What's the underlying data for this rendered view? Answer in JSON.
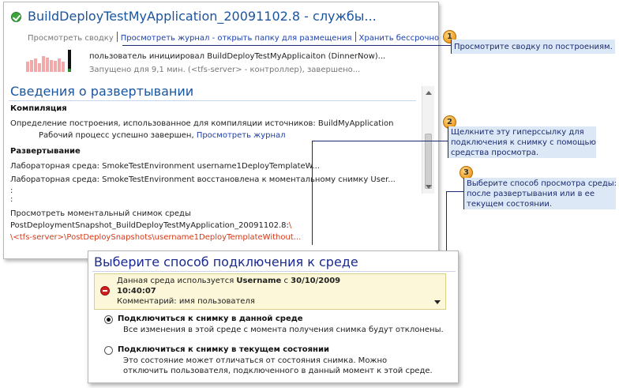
{
  "build": {
    "title": "BuildDeployTestMyApplication_20091102.8 - службы...",
    "links": {
      "summary": "Просмотреть сводку",
      "log_open": "Просмотреть журнал - открыть папку для размещения",
      "keep": "Хранить бессрочно"
    },
    "initiated": "пользователь инициировал BuildDeployTestMyApplicaiton (DinnerNow)...",
    "running": "Запущено для 9,1 мин. (<tfs-server> - контроллер), завершено...",
    "history_bars": [
      {
        "height": 0.45,
        "status": "failed"
      },
      {
        "height": 0.55,
        "status": "failed"
      },
      {
        "height": 0.6,
        "status": "failed"
      },
      {
        "height": 0.4,
        "status": "failed"
      },
      {
        "height": 0.7,
        "status": "failed"
      },
      {
        "height": 0.65,
        "status": "failed"
      },
      {
        "height": 0.55,
        "status": "failed"
      },
      {
        "height": 0.5,
        "status": "failed"
      },
      {
        "height": 0.6,
        "status": "failed"
      },
      {
        "height": 0.45,
        "status": "failed"
      },
      {
        "height": 1.0,
        "status": "current"
      }
    ]
  },
  "deployment": {
    "section_title": "Сведения о развертывании",
    "compile_heading": "Компиляция",
    "compile_definition": "Определение построения, использованное для компиляции источников: BuildMyApplication",
    "compile_result": "Рабочий процесс успешно завершен,",
    "compile_log_link": "Просмотреть журнал",
    "deploy_heading": "Развертывание",
    "lab_line1": "Лабораторная среда: SmokeTestEnvironment username1DeployTemplateW...",
    "lab_line2": "Лабораторная среда: SmokeTestEnvironment восстановлена к моментальному снимку User...",
    "dots": ":",
    "snapshot_label": "Просмотреть моментальный снимок среды",
    "snapshot_name": "PostDeploymentSnapshot_BuildDeployTestMyApplication_20091102.8:",
    "snapshot_suffix": "\\",
    "snapshot_path": "\\<tfs-server>\\PostDeploySnapshots\\username1DeployTemplateWithout..."
  },
  "callouts": [
    {
      "number": "1",
      "lines": [
        "Просмотрите сводку по построениям."
      ]
    },
    {
      "number": "2",
      "lines": [
        "Щелкните эту гиперссылку для",
        "подключения к снимку с помощью",
        "средства просмотра."
      ]
    },
    {
      "number": "3",
      "lines": [
        "Выберите способ просмотра среды:",
        "после развертывания или в ее",
        "текущем состоянии."
      ]
    }
  ],
  "connect": {
    "title": "Выберите способ подключения к среде",
    "warning_prefix": "Данная среда используется",
    "warning_user": "Username",
    "warning_with": "с",
    "warning_date": "30/10/2009",
    "warning_time": "10:40:07",
    "warning_comment": "Комментарий: имя пользователя",
    "option1_title": "Подключиться к снимку в данной среде",
    "option1_desc": "Все изменения в этой среде с момента получения снимка будут отклонены.",
    "option2_title": "Подключиться к снимку в текущем состоянии",
    "option2_desc1": "Это состояние может отличаться от состояния снимка. Можно",
    "option2_desc2": "отключить пользователя, подключенного в данный момент к этой среде."
  }
}
